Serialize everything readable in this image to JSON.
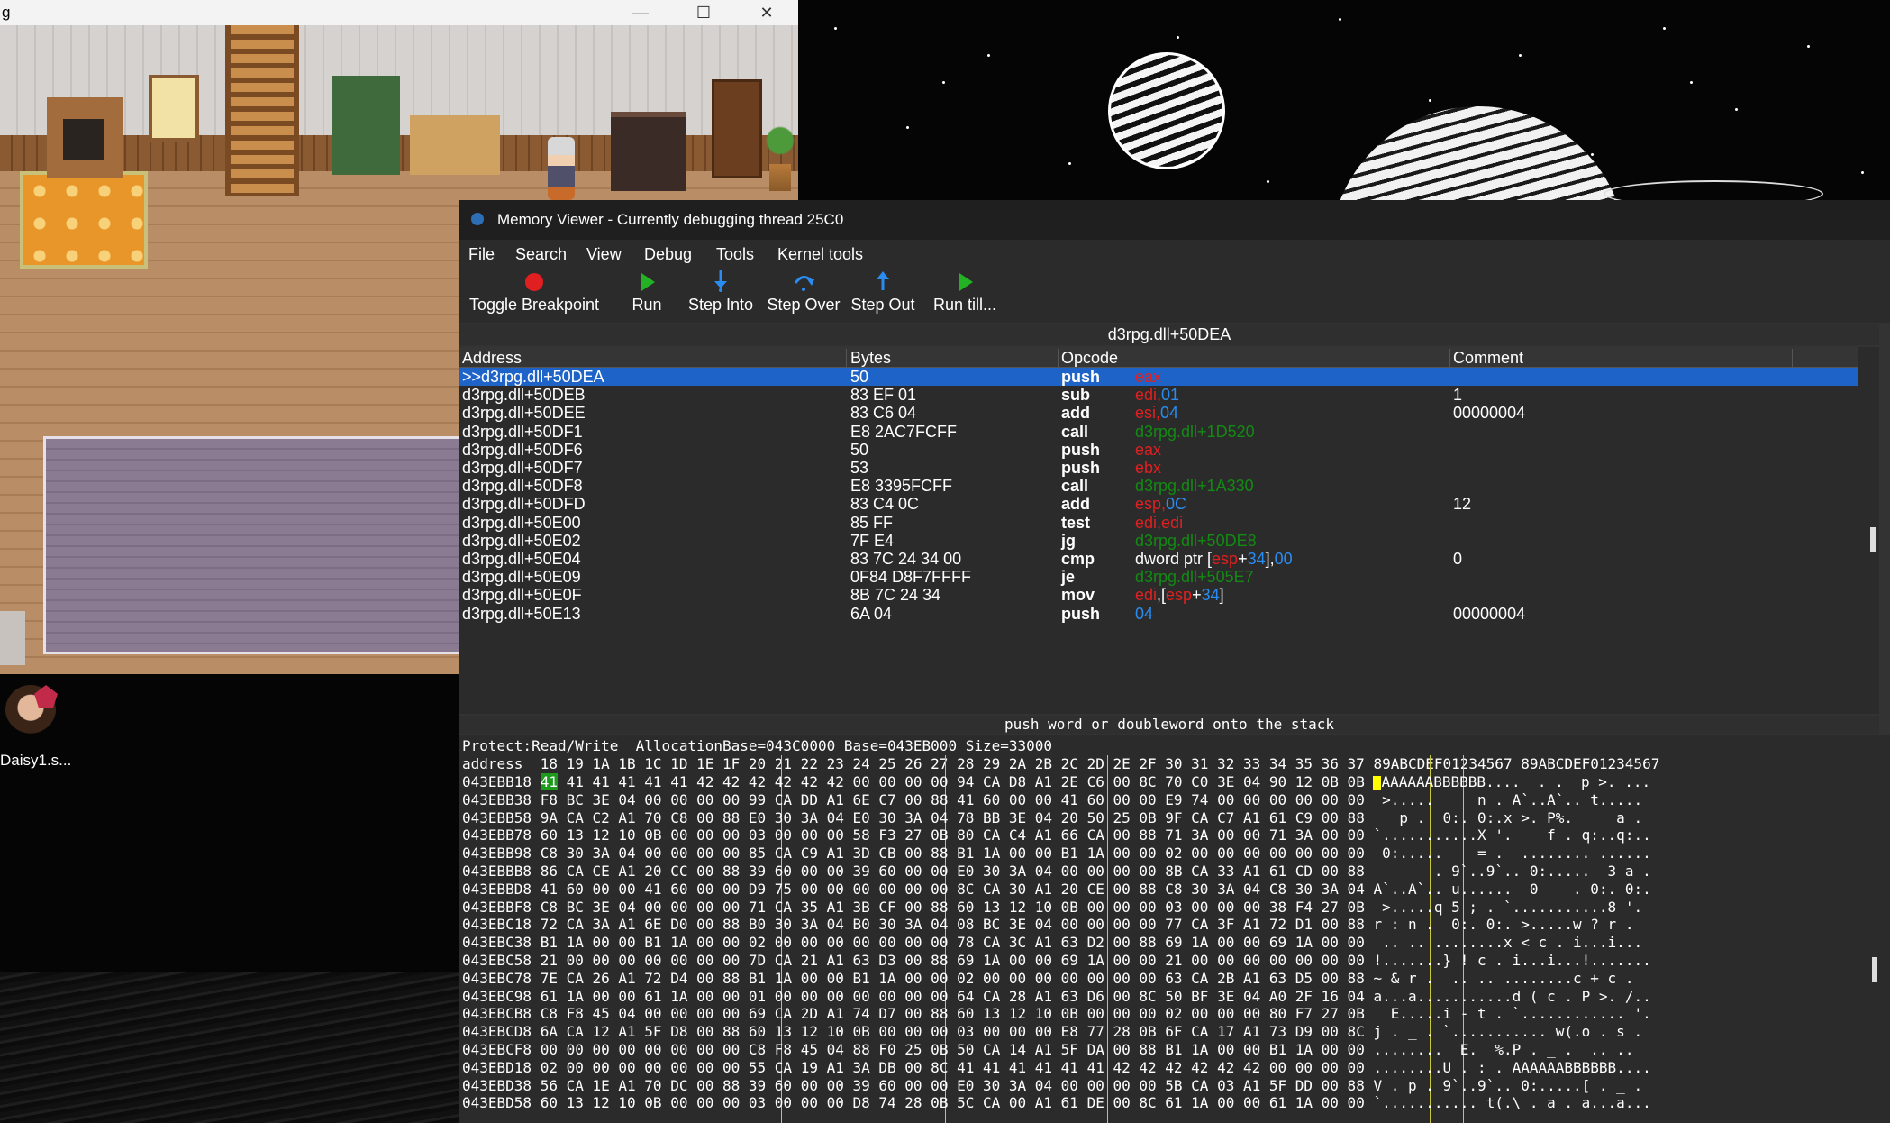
{
  "game": {
    "title": "g",
    "controls": {
      "minimize": "—",
      "maximize": "☐",
      "close": "✕"
    }
  },
  "desktop": {
    "icon_label": "Daisy1.s..."
  },
  "memory_viewer": {
    "title": "Memory Viewer - Currently debugging thread 25C0",
    "menu": [
      "File",
      "Search",
      "View",
      "Debug",
      "Tools",
      "Kernel tools"
    ],
    "toolbar": [
      {
        "label": "Toggle Breakpoint",
        "icon": "breakpoint-icon",
        "color": "#e02020"
      },
      {
        "label": "Run",
        "icon": "run-icon",
        "color": "#23b223"
      },
      {
        "label": "Step Into",
        "icon": "step-into-icon",
        "color": "#2a8cf0"
      },
      {
        "label": "Step Over",
        "icon": "step-over-icon",
        "color": "#2a8cf0"
      },
      {
        "label": "Step Out",
        "icon": "step-out-icon",
        "color": "#2a8cf0"
      },
      {
        "label": "Run till...",
        "icon": "run-till-icon",
        "color": "#23b223"
      }
    ],
    "location": "d3rpg.dll+50DEA",
    "columns": [
      "Address",
      "Bytes",
      "Opcode",
      "Comment"
    ],
    "rows": [
      {
        "address": ">>d3rpg.dll+50DEA",
        "bytes": "50",
        "opcode": "push",
        "args": [
          {
            "t": "eax",
            "c": "reg"
          }
        ],
        "comment": "",
        "selected": true
      },
      {
        "address": "d3rpg.dll+50DEB",
        "bytes": "83 EF 01",
        "opcode": "sub",
        "args": [
          {
            "t": "edi",
            "c": "reg"
          },
          {
            "t": ",",
            "c": "reg"
          },
          {
            "t": "01",
            "c": "num"
          }
        ],
        "comment": "1"
      },
      {
        "address": "d3rpg.dll+50DEE",
        "bytes": "83 C6 04",
        "opcode": "add",
        "args": [
          {
            "t": "esi",
            "c": "reg"
          },
          {
            "t": ",",
            "c": "reg"
          },
          {
            "t": "04",
            "c": "num"
          }
        ],
        "comment": "00000004"
      },
      {
        "address": "d3rpg.dll+50DF1",
        "bytes": "E8 2AC7FCFF",
        "opcode": "call",
        "args": [
          {
            "t": "d3rpg.dll+1D520",
            "c": "sym"
          }
        ],
        "comment": ""
      },
      {
        "address": "d3rpg.dll+50DF6",
        "bytes": "50",
        "opcode": "push",
        "args": [
          {
            "t": "eax",
            "c": "reg"
          }
        ],
        "comment": ""
      },
      {
        "address": "d3rpg.dll+50DF7",
        "bytes": "53",
        "opcode": "push",
        "args": [
          {
            "t": "ebx",
            "c": "reg"
          }
        ],
        "comment": ""
      },
      {
        "address": "d3rpg.dll+50DF8",
        "bytes": "E8 3395FCFF",
        "opcode": "call",
        "args": [
          {
            "t": "d3rpg.dll+1A330",
            "c": "sym"
          }
        ],
        "comment": ""
      },
      {
        "address": "d3rpg.dll+50DFD",
        "bytes": "83 C4 0C",
        "opcode": "add",
        "args": [
          {
            "t": "esp",
            "c": "reg"
          },
          {
            "t": ",",
            "c": "reg"
          },
          {
            "t": "0C",
            "c": "num"
          }
        ],
        "comment": "12"
      },
      {
        "address": "d3rpg.dll+50E00",
        "bytes": "85 FF",
        "opcode": "test",
        "args": [
          {
            "t": "edi",
            "c": "reg"
          },
          {
            "t": ",",
            "c": "reg"
          },
          {
            "t": "edi",
            "c": "reg"
          }
        ],
        "comment": ""
      },
      {
        "address": "d3rpg.dll+50E02",
        "bytes": "7F E4",
        "opcode": "jg",
        "args": [
          {
            "t": "d3rpg.dll+50DE8",
            "c": "sym"
          }
        ],
        "comment": ""
      },
      {
        "address": "d3rpg.dll+50E04",
        "bytes": "83 7C 24 34 00",
        "opcode": "cmp",
        "args": [
          {
            "t": "dword ptr [",
            "c": "txt"
          },
          {
            "t": "esp",
            "c": "reg"
          },
          {
            "t": "+",
            "c": "txt"
          },
          {
            "t": "34",
            "c": "num"
          },
          {
            "t": "],",
            "c": "txt"
          },
          {
            "t": "00",
            "c": "num"
          }
        ],
        "comment": "0"
      },
      {
        "address": "d3rpg.dll+50E09",
        "bytes": "0F84 D8F7FFFF",
        "opcode": "je",
        "args": [
          {
            "t": "d3rpg.dll+505E7",
            "c": "sym"
          }
        ],
        "comment": ""
      },
      {
        "address": "d3rpg.dll+50E0F",
        "bytes": "8B 7C 24 34",
        "opcode": "mov",
        "args": [
          {
            "t": "edi",
            "c": "reg"
          },
          {
            "t": ",[",
            "c": "txt"
          },
          {
            "t": "esp",
            "c": "reg"
          },
          {
            "t": "+",
            "c": "txt"
          },
          {
            "t": "34",
            "c": "num"
          },
          {
            "t": "]",
            "c": "txt"
          }
        ],
        "comment": ""
      },
      {
        "address": "d3rpg.dll+50E13",
        "bytes": "6A 04",
        "opcode": "push",
        "args": [
          {
            "t": "04",
            "c": "num"
          }
        ],
        "comment": "00000004"
      }
    ],
    "status": "push word or doubleword onto the stack",
    "hex": {
      "info": "Protect:Read/Write  AllocationBase=043C0000 Base=043EB000 Size=33000",
      "header": "address  18 19 1A 1B 1C 1D 1E 1F 20 21 22 23 24 25 26 27 28 29 2A 2B 2C 2D 2E 2F 30 31 32 33 34 35 36 37 89ABCDEF01234567 89ABCDEF01234567",
      "rows": [
        {
          "addr": "043EBB18",
          "bytes": "41 41 41 41 41 41 42 42 42 42 42 42 00 00 00 00 94 CA D8 A1 2E C6 00 8C 70 C0 3E 04 90 12 0B 0B",
          "ascii": "AAAAAABBBBBB....  . .  p >. ..."
        },
        {
          "addr": "043EBB38",
          "bytes": "F8 BC 3E 04 00 00 00 00 99 CA DD A1 6E C7 00 88 41 60 00 00 41 60 00 00 E9 74 00 00 00 00 00 00",
          "ascii": " >.....     n . A`..A`.. t....."
        },
        {
          "addr": "043EBB58",
          "bytes": "9A CA C2 A1 70 C8 00 88 E0 30 3A 04 E0 30 3A 04 78 BB 3E 04 20 50 25 0B 9F CA C7 A1 61 C9 00 88",
          "ascii": "   p .  0:. 0:.x >. P%.     a ."
        },
        {
          "addr": "043EBB78",
          "bytes": "60 13 12 10 0B 00 00 00 03 00 00 00 58 F3 27 0B 80 CA C4 A1 66 CA 00 88 71 3A 00 00 71 3A 00 00",
          "ascii": "`...........X '.    f . q:..q:.."
        },
        {
          "addr": "043EBB98",
          "bytes": "C8 30 3A 04 00 00 00 00 85 CA C9 A1 3D CB 00 88 B1 1A 00 00 B1 1A 00 00 02 00 00 00 00 00 00 00",
          "ascii": " 0:.....    = .  ........ ......"
        },
        {
          "addr": "043EBBB8",
          "bytes": "86 CA CE A1 20 CC 00 88 39 60 00 00 39 60 00 00 E0 30 3A 04 00 00 00 00 8B CA 33 A1 61 CD 00 88",
          "ascii": "       . 9`..9`.. 0:.....  3 a ."
        },
        {
          "addr": "043EBBD8",
          "bytes": "41 60 00 00 41 60 00 00 D9 75 00 00 00 00 00 00 8C CA 30 A1 20 CE 00 88 C8 30 3A 04 C8 30 3A 04",
          "ascii": "A`..A`.. u......  0    . 0:. 0:."
        },
        {
          "addr": "043EBBF8",
          "bytes": "C8 BC 3E 04 00 00 00 00 71 CA 35 A1 3B CF 00 88 60 13 12 10 0B 00 00 00 03 00 00 00 38 F4 27 0B",
          "ascii": " >.....q 5 ; . `...........8 '."
        },
        {
          "addr": "043EBC18",
          "bytes": "72 CA 3A A1 6E D0 00 88 B0 30 3A 04 B0 30 3A 04 08 BC 3E 04 00 00 00 00 77 CA 3F A1 72 D1 00 88",
          "ascii": "r : n .  0:. 0:. >.....w ? r ."
        },
        {
          "addr": "043EBC38",
          "bytes": "B1 1A 00 00 B1 1A 00 00 02 00 00 00 00 00 00 00 78 CA 3C A1 63 D2 00 88 69 1A 00 00 69 1A 00 00",
          "ascii": " .. .. ........x < c . i...i..."
        },
        {
          "addr": "043EBC58",
          "bytes": "21 00 00 00 00 00 00 00 7D CA 21 A1 63 D3 00 88 69 1A 00 00 69 1A 00 00 21 00 00 00 00 00 00 00",
          "ascii": "!.......} ! c . i...i...!......."
        },
        {
          "addr": "043EBC78",
          "bytes": "7E CA 26 A1 72 D4 00 88 B1 1A 00 00 B1 1A 00 00 02 00 00 00 00 00 00 00 63 CA 2B A1 63 D5 00 88",
          "ascii": "~ & r .  .. .. ........c + c ."
        },
        {
          "addr": "043EBC98",
          "bytes": "61 1A 00 00 61 1A 00 00 01 00 00 00 00 00 00 00 64 CA 28 A1 63 D6 00 8C 50 BF 3E 04 A0 2F 16 04",
          "ascii": "a...a...........d ( c . P >. /.."
        },
        {
          "addr": "043EBCB8",
          "bytes": "C8 F8 45 04 00 00 00 00 69 CA 2D A1 74 D7 00 88 60 13 12 10 0B 00 00 00 02 00 00 00 80 F7 27 0B",
          "ascii": "  E.....i - t . `............ '."
        },
        {
          "addr": "043EBCD8",
          "bytes": "6A CA 12 A1 5F D8 00 88 60 13 12 10 0B 00 00 00 03 00 00 00 E8 77 28 0B 6F CA 17 A1 73 D9 00 8C",
          "ascii": "j . _ . `........... w(.o . s ."
        },
        {
          "addr": "043EBCF8",
          "bytes": "00 00 00 00 00 00 00 00 C8 F8 45 04 88 F0 25 0B 50 CA 14 A1 5F DA 00 88 B1 1A 00 00 B1 1A 00 00",
          "ascii": "........  E.  %.P . _ .  .. .."
        },
        {
          "addr": "043EBD18",
          "bytes": "02 00 00 00 00 00 00 00 55 CA 19 A1 3A DB 00 8C 41 41 41 41 41 41 42 42 42 42 42 42 00 00 00 00",
          "ascii": "........U . : . AAAAAABBBBBB...."
        },
        {
          "addr": "043EBD38",
          "bytes": "56 CA 1E A1 70 DC 00 88 39 60 00 00 39 60 00 00 E0 30 3A 04 00 00 00 00 5B CA 03 A1 5F DD 00 88",
          "ascii": "V . p . 9`..9`.. 0:.....[ . _ ."
        },
        {
          "addr": "043EBD58",
          "bytes": "60 13 12 10 0B 00 00 00 03 00 00 00 D8 74 28 0B 5C CA 00 A1 61 DE 00 8C 61 1A 00 00 61 1A 00 00",
          "ascii": "`........... t(.\\ . a . a...a..."
        }
      ]
    }
  }
}
